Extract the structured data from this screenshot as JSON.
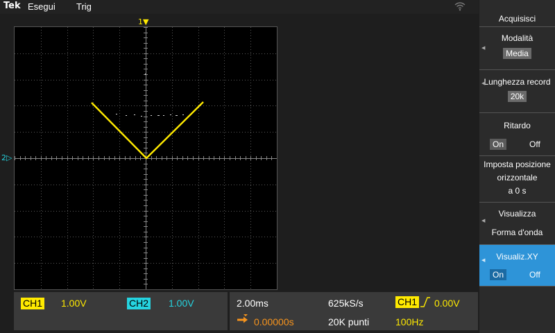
{
  "topbar": {
    "logo": "Tek",
    "menu_run": "Esegui",
    "menu_trig": "Trig",
    "help": "?"
  },
  "screen": {
    "trigger_marker": "1▼",
    "ch2_marker": "2▷",
    "trace_color": "#ffea00"
  },
  "status": {
    "ch1_label": "CH1",
    "ch1_scale": "1.00V",
    "ch2_label": "CH2",
    "ch2_scale": "1.00V",
    "timebase": "2.00ms",
    "sample_rate": "625kS/s",
    "trigger_source": "CH1",
    "trigger_level": "0.00V",
    "delay": "0.00000s",
    "record_points": "20K punti",
    "trigger_freq": "100Hz"
  },
  "side_menu": {
    "title": "Acquisisci",
    "mode_label": "Modalità",
    "mode_value": "Media",
    "record_label": "Lunghezza record",
    "record_value": "20k",
    "delay_label": "Ritardo",
    "delay_on": "On",
    "delay_off": "Off",
    "hpos_line1": "Imposta posizione",
    "hpos_line2": "orizzontale",
    "hpos_line3": "a 0 s",
    "display_label": "Visualizza",
    "display_value": "Forma d'onda",
    "xy_label": "Visualiz.XY",
    "xy_on": "On",
    "xy_off": "Off"
  },
  "colors": {
    "ch1": "#ffea00",
    "ch2": "#25d4e0",
    "highlight": "#2e94d8"
  }
}
